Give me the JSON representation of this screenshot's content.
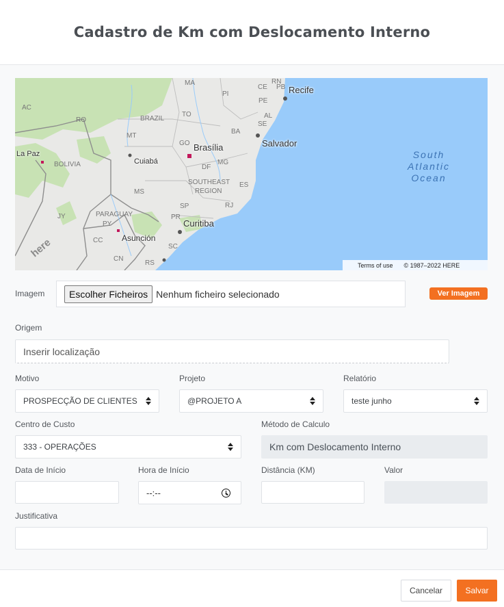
{
  "header": {
    "title": "Cadastro de Km com Deslocamento Interno"
  },
  "map": {
    "state_labels": [
      "PI",
      "CE",
      "PE",
      "AL",
      "SE",
      "PB",
      "RN",
      "MA",
      "AC",
      "RO",
      "BRAZIL",
      "TO",
      "MT",
      "BA",
      "GO",
      "DF",
      "MG",
      "ES",
      "MS",
      "SP",
      "RJ",
      "PR",
      "SC",
      "RS",
      "PY",
      "JY",
      "CC",
      "CN",
      "BOLIVIA",
      "PARAGUAY",
      "SOUTHEAST",
      "REGION"
    ],
    "cities": {
      "recife": "Recife",
      "salvador": "Salvador",
      "brasilia": "Brasília",
      "la_paz": "La Paz",
      "cuiaba": "Cuiabá",
      "curitiba": "Curitiba",
      "asuncion": "Asunción"
    },
    "ocean_label": [
      "South",
      "Atlantic",
      "Ocean"
    ],
    "watermark": "here",
    "attribution": {
      "terms": "Terms of use",
      "copyright": "© 1987–2022 HERE"
    },
    "colors": {
      "ocean": "#99cbfa",
      "land": "#e9e9e7",
      "forest": "#c8e2b4"
    }
  },
  "form": {
    "imagem": {
      "label": "Imagem",
      "button": "Escolher Ficheiros",
      "status": "Nenhum ficheiro selecionado",
      "view_button": "Ver Imagem"
    },
    "origem": {
      "label": "Origem",
      "placeholder": "Inserir localização"
    },
    "motivo": {
      "label": "Motivo",
      "value": "PROSPECÇÃO DE CLIENTES"
    },
    "projeto": {
      "label": "Projeto",
      "value": "@PROJETO A"
    },
    "relatorio": {
      "label": "Relatório",
      "value": "teste junho"
    },
    "centro_custo": {
      "label": "Centro de Custo",
      "value": "333 - OPERAÇÕES"
    },
    "metodo_calculo": {
      "label": "Método de Calculo",
      "value": "Km com Deslocamento Interno"
    },
    "data_inicio": {
      "label": "Data de Início",
      "value": ""
    },
    "hora_inicio": {
      "label": "Hora de Início",
      "value": "--:--"
    },
    "distancia": {
      "label": "Distância (KM)",
      "value": ""
    },
    "valor": {
      "label": "Valor",
      "value": ""
    },
    "justificativa": {
      "label": "Justificativa",
      "value": ""
    }
  },
  "footer": {
    "cancel": "Cancelar",
    "save": "Salvar"
  },
  "colors": {
    "accent": "#f37021",
    "readonly_bg": "#e9ecef"
  }
}
